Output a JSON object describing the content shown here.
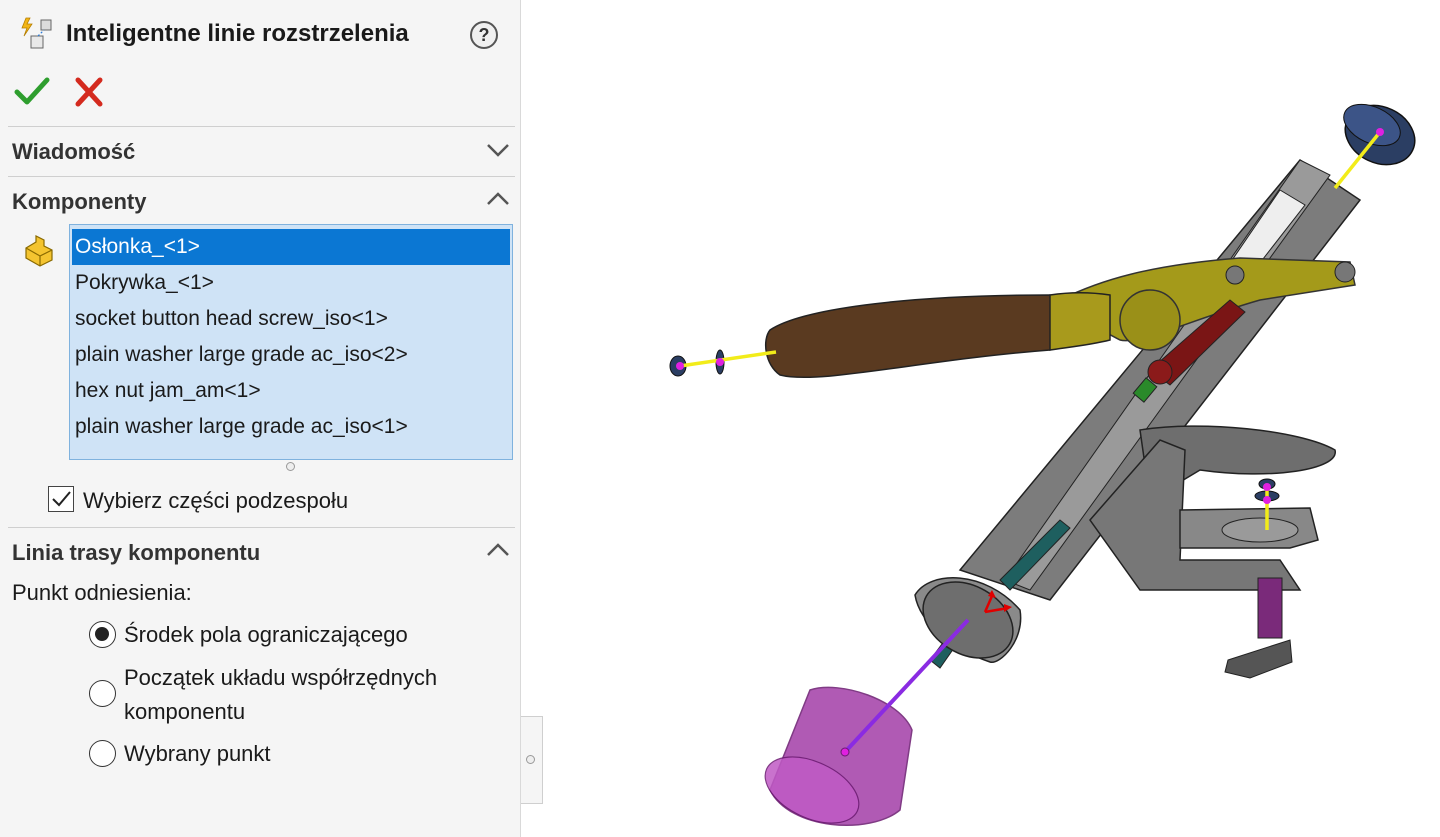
{
  "panel": {
    "title": "Inteligentne linie rozstrzelenia",
    "help_label": "?",
    "ok_icon": "checkmark-icon",
    "cancel_icon": "close-icon"
  },
  "sections": {
    "message": {
      "title": "Wiadomość",
      "collapsed": true
    },
    "components": {
      "title": "Komponenty",
      "collapsed": false,
      "items": [
        "Osłonka_<1>",
        "Pokrywka_<1>",
        "socket button head screw_iso<1>",
        "plain washer large grade ac_iso<2>",
        "hex nut jam_am<1>",
        "plain washer large grade ac_iso<1>"
      ],
      "selected_index": 0,
      "subassembly_checkbox": {
        "label": "Wybierz części podzespołu",
        "checked": true
      }
    },
    "route_line": {
      "title": "Linia trasy komponentu",
      "collapsed": false,
      "reference_label": "Punkt odniesienia:",
      "options": [
        {
          "line1": "Środek pola ograniczającego",
          "line2": "",
          "selected": true
        },
        {
          "line1": "Początek układu współrzędnych",
          "line2": "komponentu",
          "selected": false
        },
        {
          "line1": "Wybrany punkt",
          "line2": "",
          "selected": false
        }
      ]
    }
  },
  "colors": {
    "selection_bg": "#0b77d3",
    "list_bg": "#cfe3f6",
    "check_green": "#2e9e2e",
    "cancel_red": "#d42a1e",
    "explode_line": "#f2ec1a",
    "route_point": "#e020e0",
    "selected_route": "#8a2be2"
  }
}
